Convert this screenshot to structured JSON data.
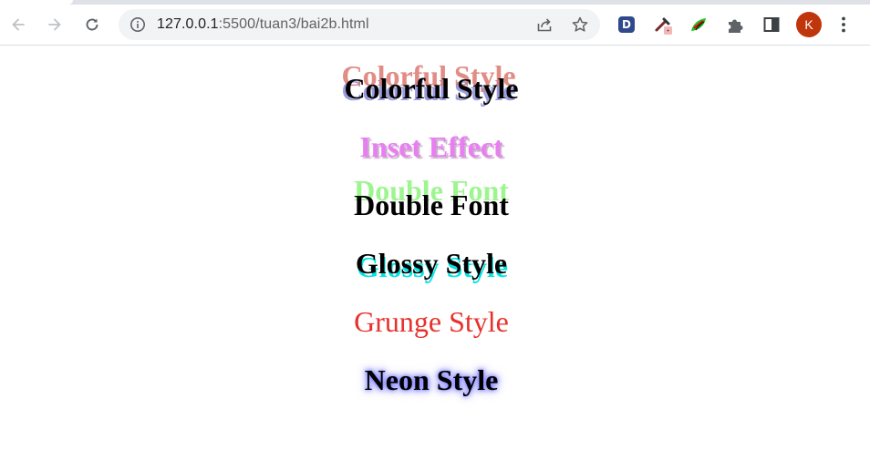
{
  "browser": {
    "url_host": "127.0.0.1",
    "url_path": ":5500/tuan3/bai2b.html",
    "profile_initial": "K",
    "extension_d_label": "D"
  },
  "content": {
    "colorful": "Colorful Style",
    "inset": "Inset Effect",
    "double": "Double Font",
    "glossy": "Glossy Style",
    "grunge": "Grunge Style",
    "neon": "Neon Style"
  },
  "icons": [
    "back-icon",
    "forward-icon",
    "reload-icon",
    "site-info-icon",
    "share-icon",
    "bookmark-star-icon",
    "extension-d-icon",
    "color-picker-extension-icon",
    "leaf-extension-icon",
    "extensions-puzzle-icon",
    "side-panel-icon",
    "profile-avatar",
    "menu-dots-icon"
  ],
  "colors": {
    "inset": "#e77ff0",
    "double_ghost": "#9df58f",
    "glossy_shadow": "#00e5e5",
    "grunge": "#e8312c",
    "neon_glow": "#6f6fff",
    "avatar": "#c0360c"
  }
}
